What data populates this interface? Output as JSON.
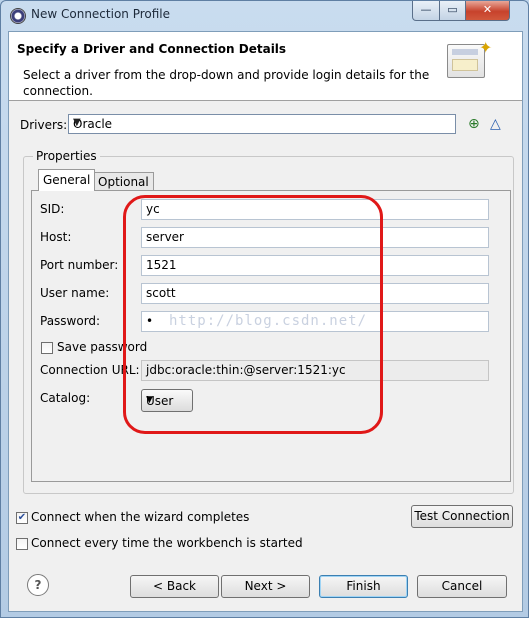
{
  "window": {
    "title": "New Connection Profile",
    "min_glyph": "—",
    "max_glyph": "▭",
    "close_glyph": "✕"
  },
  "header": {
    "title": "Specify a Driver and Connection Details",
    "description": "Select a driver from the drop-down and provide login details for the connection."
  },
  "drivers": {
    "label": "Drivers:",
    "value": "Oracle",
    "icons": [
      "new-driver-icon",
      "edit-driver-icon"
    ]
  },
  "properties": {
    "group_label": "Properties",
    "tabs": [
      {
        "label": "General",
        "selected": true
      },
      {
        "label": "Optional",
        "selected": false
      }
    ],
    "fields": {
      "sid": {
        "label": "SID:",
        "value": "yc"
      },
      "host": {
        "label": "Host:",
        "value": "server"
      },
      "port": {
        "label": "Port number:",
        "value": "1521"
      },
      "user": {
        "label": "User name:",
        "value": "scott"
      },
      "password": {
        "label": "Password:",
        "value": "•"
      }
    },
    "save_password": {
      "label": "Save password",
      "checked": false
    },
    "connection_url": {
      "label": "Connection URL:",
      "value": "jdbc:oracle:thin:@server:1521:yc"
    },
    "catalog": {
      "label": "Catalog:",
      "value": "User"
    }
  },
  "watermark": "http://blog.csdn.net/",
  "options": {
    "connect_when_complete": {
      "label": "Connect when the wizard completes",
      "checked": true
    },
    "connect_every_time": {
      "label": "Connect every time the workbench is started",
      "checked": false
    }
  },
  "buttons": {
    "test_connection": "Test Connection",
    "help": "?",
    "back": "< Back",
    "next": "Next >",
    "finish": "Finish",
    "cancel": "Cancel"
  }
}
